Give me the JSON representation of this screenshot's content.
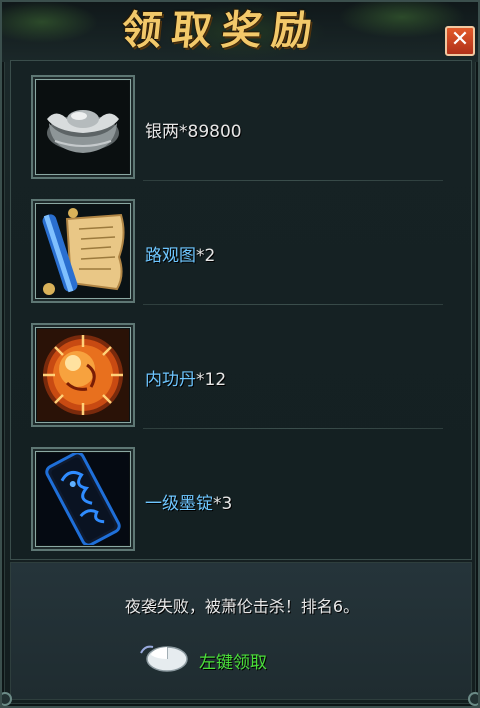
{
  "dialog": {
    "title": "领取奖励",
    "close_symbol": "✕"
  },
  "rewards": [
    {
      "icon": "silver-ingot-icon",
      "name": "银两",
      "quantity": "*89800",
      "name_color": "white"
    },
    {
      "icon": "map-scroll-icon",
      "name": "路观图",
      "quantity": "*2",
      "name_color": "blue"
    },
    {
      "icon": "inner-power-pill-icon",
      "name": "内功丹",
      "quantity": "*12",
      "name_color": "blue"
    },
    {
      "icon": "ink-stick-icon",
      "name": "一级墨锭",
      "quantity": "*3",
      "name_color": "blue"
    }
  ],
  "footer": {
    "message": "夜袭失败，被萧伦击杀！排名6。",
    "claim_label": "左键领取",
    "claim_icon": "mouse-left-click-icon"
  },
  "colors": {
    "title": "#f3c96a",
    "item_name_blue": "#6ec6ff",
    "claim_green": "#4be03a",
    "close_red": "#c23a1e"
  }
}
